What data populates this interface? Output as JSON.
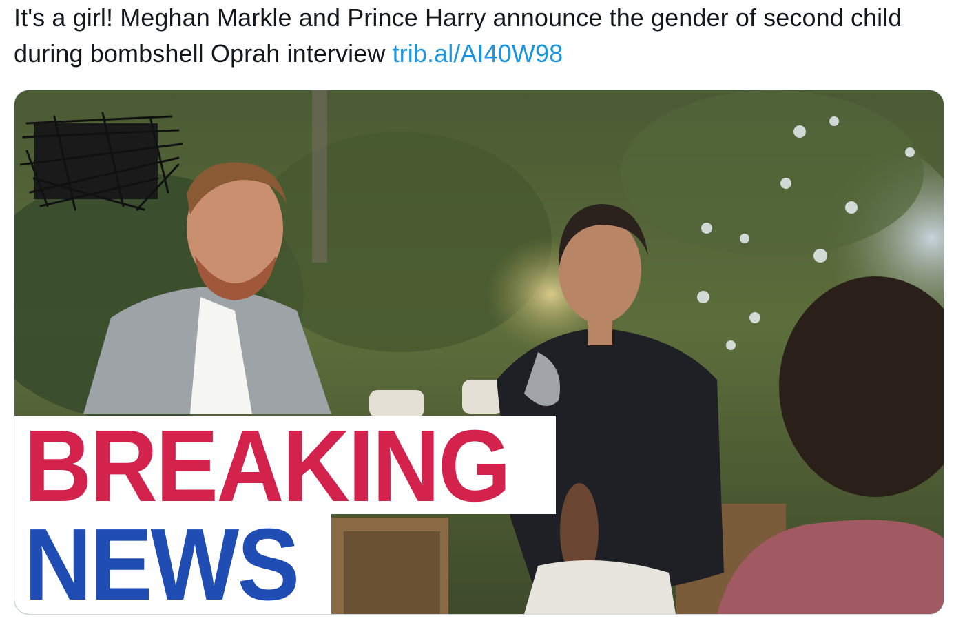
{
  "tweet": {
    "text": "It's a girl! Meghan Markle and Prince Harry announce the gender of second child during bombshell Oprah interview ",
    "link": "trib.al/AI40W98"
  },
  "media": {
    "overlay_line1": "BREAKING",
    "overlay_line2": "NEWS",
    "colors": {
      "breaking": "#d3224b",
      "news": "#1f4db4",
      "link": "#1b95e0"
    }
  }
}
